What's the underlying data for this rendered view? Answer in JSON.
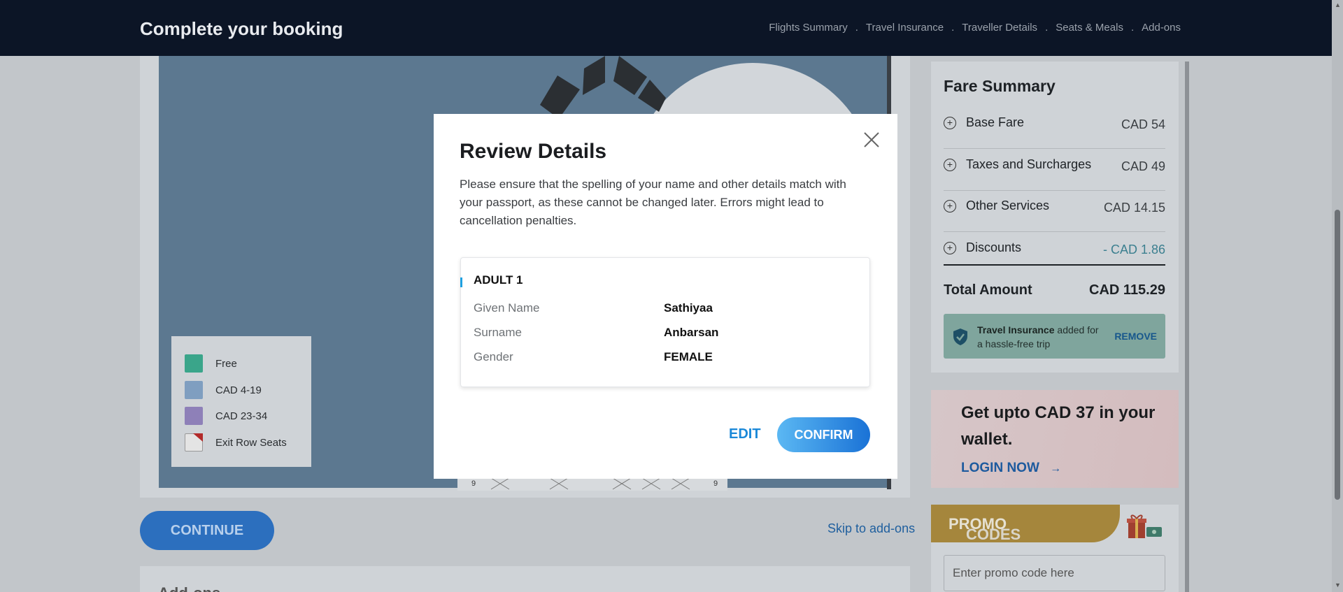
{
  "header": {
    "title": "Complete your booking",
    "steps": [
      "Flights Summary",
      "Travel Insurance",
      "Traveller Details",
      "Seats & Meals",
      "Add-ons"
    ],
    "step_separator": "."
  },
  "seatmap": {
    "legend": [
      {
        "label": "Free",
        "color": "#3aa58a"
      },
      {
        "label": "CAD 4-19",
        "color": "#7f9ec0"
      },
      {
        "label": "CAD 23-34",
        "color": "#8e80b8"
      },
      {
        "label": "Exit Row Seats",
        "color": "#e4e4e4"
      }
    ],
    "row_numbers": [
      "9",
      "9"
    ]
  },
  "actions": {
    "continue_label": "CONTINUE",
    "skip_label": "Skip to add-ons",
    "addons_title": "Add-ons"
  },
  "fare_summary": {
    "title": "Fare Summary",
    "rows": [
      {
        "label": "Base Fare",
        "amount": "CAD 54"
      },
      {
        "label": "Taxes and Surcharges",
        "amount": "CAD 49"
      },
      {
        "label": "Other Services",
        "amount": "CAD 14.15"
      },
      {
        "label": "Discounts",
        "amount": "- CAD 1.86"
      }
    ],
    "total_label": "Total Amount",
    "total_amount": "CAD 115.29",
    "insurance": {
      "bold": "Travel Insurance",
      "rest": " added for a hassle-free trip",
      "remove_label": "REMOVE"
    }
  },
  "wallet": {
    "headline": "Get upto CAD 37 in your wallet.",
    "login_label": "LOGIN NOW",
    "arrow": "→"
  },
  "promo": {
    "title_a": "PROMO",
    "title_b": " CODES",
    "placeholder": "Enter promo code here"
  },
  "modal": {
    "title": "Review Details",
    "description": "Please ensure that the spelling of your name and other details match with your passport, as these cannot be changed later. Errors might lead to cancellation penalties.",
    "passenger": {
      "title": "ADULT 1",
      "fields": [
        {
          "label": "Given Name",
          "value": "Sathiyaa"
        },
        {
          "label": "Surname",
          "value": "Anbarsan"
        },
        {
          "label": "Gender",
          "value": "FEMALE"
        }
      ]
    },
    "edit_label": "EDIT",
    "confirm_label": "CONFIRM"
  },
  "colors": {
    "header_bg": "#0c1526",
    "accent_blue": "#1a88d8",
    "confirm_gradient_start": "#5bb8f3",
    "confirm_gradient_end": "#1a72d6"
  }
}
